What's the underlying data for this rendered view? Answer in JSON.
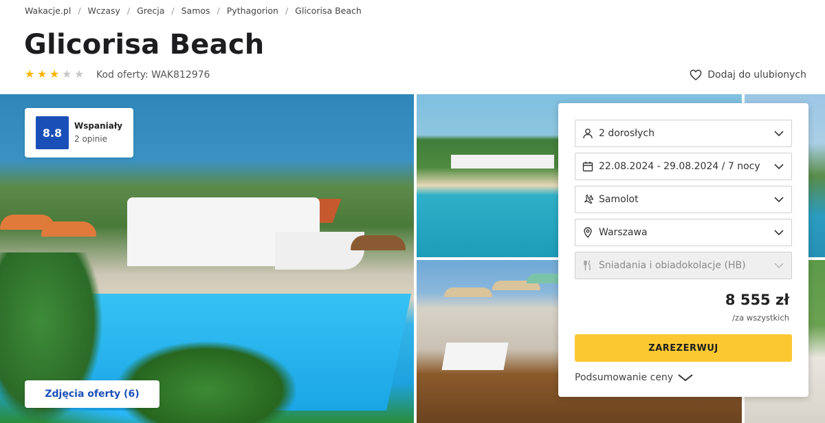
{
  "breadcrumb": [
    "Wakacje.pl",
    "Wczasy",
    "Grecja",
    "Samos",
    "Pythagorion",
    "Glicorisa Beach"
  ],
  "title": "Glicorisa Beach",
  "stars": {
    "rating": 3,
    "max": 5
  },
  "offer_code": "Kod oferty: WAK812976",
  "favorite_label": "Dodaj do ulubionych",
  "rating": {
    "score": "8.8",
    "label": "Wspaniały",
    "count": "2 opinie"
  },
  "photos_button": "Zdjęcia oferty (6)",
  "booking": {
    "travelers": "2 dorosłych",
    "dates": "22.08.2024 - 29.08.2024 / 7 nocy",
    "transport": "Samolot",
    "departure": "Warszawa",
    "board": "Śniadania i obiadokolacje (HB)",
    "price": "8 555 zł",
    "price_note": "/za wszystkich",
    "reserve_label": "ZAREZERWUJ",
    "summary_label": "Podsumowanie ceny"
  },
  "colors": {
    "brand_blue": "#1b4fb8",
    "cta_yellow": "#fbc831",
    "star": "#f7b500"
  }
}
